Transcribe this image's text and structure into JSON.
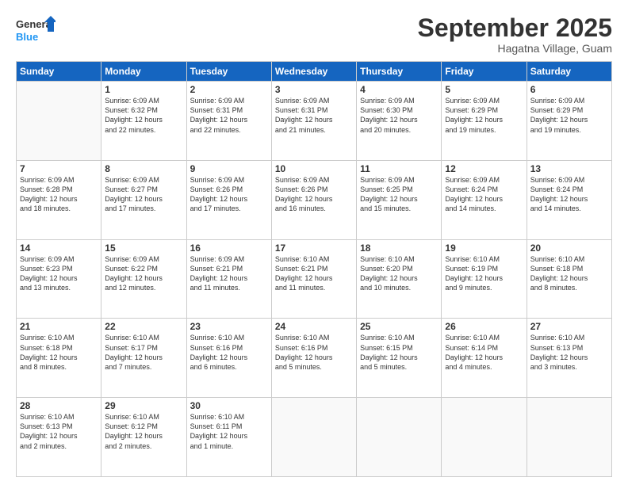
{
  "logo": {
    "line1": "General",
    "line2": "Blue"
  },
  "title": "September 2025",
  "subtitle": "Hagatna Village, Guam",
  "weekdays": [
    "Sunday",
    "Monday",
    "Tuesday",
    "Wednesday",
    "Thursday",
    "Friday",
    "Saturday"
  ],
  "weeks": [
    [
      {
        "day": "",
        "info": ""
      },
      {
        "day": "1",
        "info": "Sunrise: 6:09 AM\nSunset: 6:32 PM\nDaylight: 12 hours\nand 22 minutes."
      },
      {
        "day": "2",
        "info": "Sunrise: 6:09 AM\nSunset: 6:31 PM\nDaylight: 12 hours\nand 22 minutes."
      },
      {
        "day": "3",
        "info": "Sunrise: 6:09 AM\nSunset: 6:31 PM\nDaylight: 12 hours\nand 21 minutes."
      },
      {
        "day": "4",
        "info": "Sunrise: 6:09 AM\nSunset: 6:30 PM\nDaylight: 12 hours\nand 20 minutes."
      },
      {
        "day": "5",
        "info": "Sunrise: 6:09 AM\nSunset: 6:29 PM\nDaylight: 12 hours\nand 19 minutes."
      },
      {
        "day": "6",
        "info": "Sunrise: 6:09 AM\nSunset: 6:29 PM\nDaylight: 12 hours\nand 19 minutes."
      }
    ],
    [
      {
        "day": "7",
        "info": "Sunrise: 6:09 AM\nSunset: 6:28 PM\nDaylight: 12 hours\nand 18 minutes."
      },
      {
        "day": "8",
        "info": "Sunrise: 6:09 AM\nSunset: 6:27 PM\nDaylight: 12 hours\nand 17 minutes."
      },
      {
        "day": "9",
        "info": "Sunrise: 6:09 AM\nSunset: 6:26 PM\nDaylight: 12 hours\nand 17 minutes."
      },
      {
        "day": "10",
        "info": "Sunrise: 6:09 AM\nSunset: 6:26 PM\nDaylight: 12 hours\nand 16 minutes."
      },
      {
        "day": "11",
        "info": "Sunrise: 6:09 AM\nSunset: 6:25 PM\nDaylight: 12 hours\nand 15 minutes."
      },
      {
        "day": "12",
        "info": "Sunrise: 6:09 AM\nSunset: 6:24 PM\nDaylight: 12 hours\nand 14 minutes."
      },
      {
        "day": "13",
        "info": "Sunrise: 6:09 AM\nSunset: 6:24 PM\nDaylight: 12 hours\nand 14 minutes."
      }
    ],
    [
      {
        "day": "14",
        "info": "Sunrise: 6:09 AM\nSunset: 6:23 PM\nDaylight: 12 hours\nand 13 minutes."
      },
      {
        "day": "15",
        "info": "Sunrise: 6:09 AM\nSunset: 6:22 PM\nDaylight: 12 hours\nand 12 minutes."
      },
      {
        "day": "16",
        "info": "Sunrise: 6:09 AM\nSunset: 6:21 PM\nDaylight: 12 hours\nand 11 minutes."
      },
      {
        "day": "17",
        "info": "Sunrise: 6:10 AM\nSunset: 6:21 PM\nDaylight: 12 hours\nand 11 minutes."
      },
      {
        "day": "18",
        "info": "Sunrise: 6:10 AM\nSunset: 6:20 PM\nDaylight: 12 hours\nand 10 minutes."
      },
      {
        "day": "19",
        "info": "Sunrise: 6:10 AM\nSunset: 6:19 PM\nDaylight: 12 hours\nand 9 minutes."
      },
      {
        "day": "20",
        "info": "Sunrise: 6:10 AM\nSunset: 6:18 PM\nDaylight: 12 hours\nand 8 minutes."
      }
    ],
    [
      {
        "day": "21",
        "info": "Sunrise: 6:10 AM\nSunset: 6:18 PM\nDaylight: 12 hours\nand 8 minutes."
      },
      {
        "day": "22",
        "info": "Sunrise: 6:10 AM\nSunset: 6:17 PM\nDaylight: 12 hours\nand 7 minutes."
      },
      {
        "day": "23",
        "info": "Sunrise: 6:10 AM\nSunset: 6:16 PM\nDaylight: 12 hours\nand 6 minutes."
      },
      {
        "day": "24",
        "info": "Sunrise: 6:10 AM\nSunset: 6:16 PM\nDaylight: 12 hours\nand 5 minutes."
      },
      {
        "day": "25",
        "info": "Sunrise: 6:10 AM\nSunset: 6:15 PM\nDaylight: 12 hours\nand 5 minutes."
      },
      {
        "day": "26",
        "info": "Sunrise: 6:10 AM\nSunset: 6:14 PM\nDaylight: 12 hours\nand 4 minutes."
      },
      {
        "day": "27",
        "info": "Sunrise: 6:10 AM\nSunset: 6:13 PM\nDaylight: 12 hours\nand 3 minutes."
      }
    ],
    [
      {
        "day": "28",
        "info": "Sunrise: 6:10 AM\nSunset: 6:13 PM\nDaylight: 12 hours\nand 2 minutes."
      },
      {
        "day": "29",
        "info": "Sunrise: 6:10 AM\nSunset: 6:12 PM\nDaylight: 12 hours\nand 2 minutes."
      },
      {
        "day": "30",
        "info": "Sunrise: 6:10 AM\nSunset: 6:11 PM\nDaylight: 12 hours\nand 1 minute."
      },
      {
        "day": "",
        "info": ""
      },
      {
        "day": "",
        "info": ""
      },
      {
        "day": "",
        "info": ""
      },
      {
        "day": "",
        "info": ""
      }
    ]
  ]
}
